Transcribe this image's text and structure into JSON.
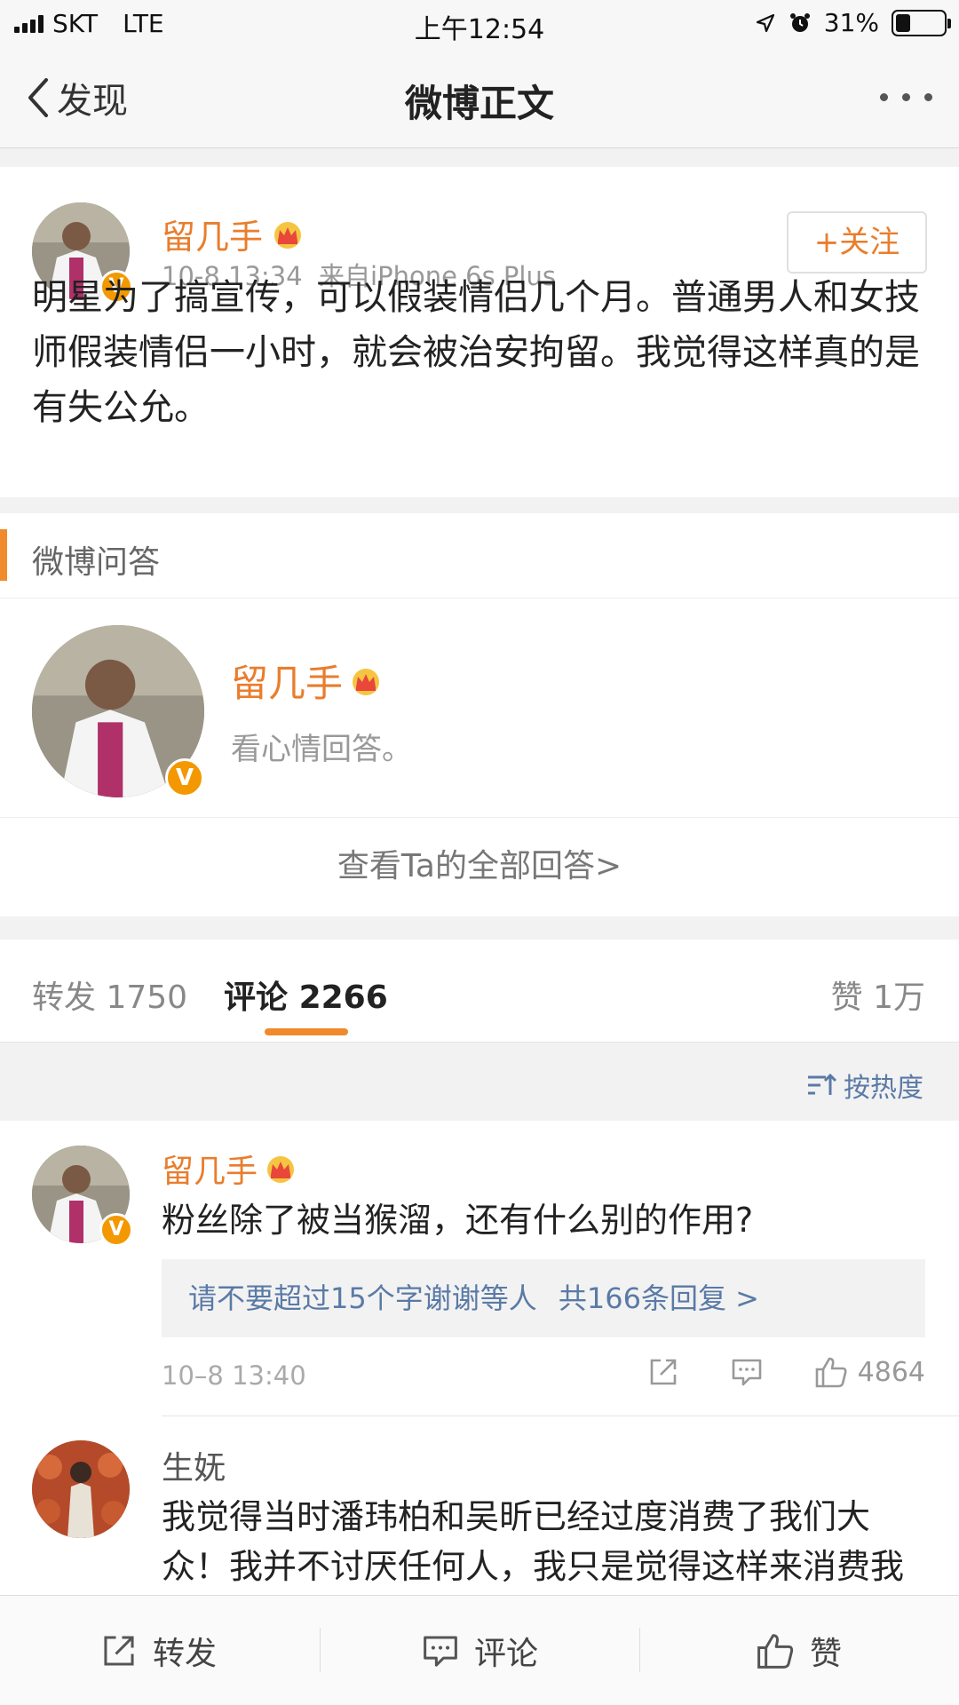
{
  "status_bar": {
    "carrier": "SKT",
    "network": "LTE",
    "time": "上午12:54",
    "battery_text": "31%",
    "battery_level": 0.31
  },
  "nav": {
    "back_label": "发现",
    "title": "微博正文"
  },
  "post": {
    "author": "留几手",
    "meta": "10-8 13:34  来自iPhone 6s Plus",
    "follow_label": "+关注",
    "text": "明星为了搞宣传，可以假装情侣几个月。普通男人和女技师假装情侣一小时，就会被治安拘留。我觉得这样真的是有失公允。"
  },
  "qa": {
    "section_title": "微博问答",
    "author": "留几手",
    "answer": "看心情回答。",
    "view_all": "查看Ta的全部回答>"
  },
  "tabs": {
    "repost_label": "转发",
    "repost_count": "1750",
    "comment_label": "评论",
    "comment_count": "2266",
    "like_label": "赞",
    "like_count": "1万"
  },
  "sort_label": "按热度",
  "comments": [
    {
      "author": "留几手",
      "text": "粉丝除了被当猴溜，还有什么别的作用?",
      "reply_preview": "请不要超过15个字谢谢等人",
      "reply_count": "共166条回复 >",
      "time": "10–8 13:40",
      "likes": "4864"
    },
    {
      "author": "生妩",
      "text": "我觉得当时潘玮柏和吴昕已经过度消费了我们大众！我并不讨厌任何人，我只是觉得这样来消费我"
    }
  ],
  "bottom_bar": {
    "repost": "转发",
    "comment": "评论",
    "like": "赞"
  },
  "colors": {
    "accent_orange": "#e97d2c",
    "link_blue": "#5a7aa6",
    "verified_badge": "#f39800"
  }
}
